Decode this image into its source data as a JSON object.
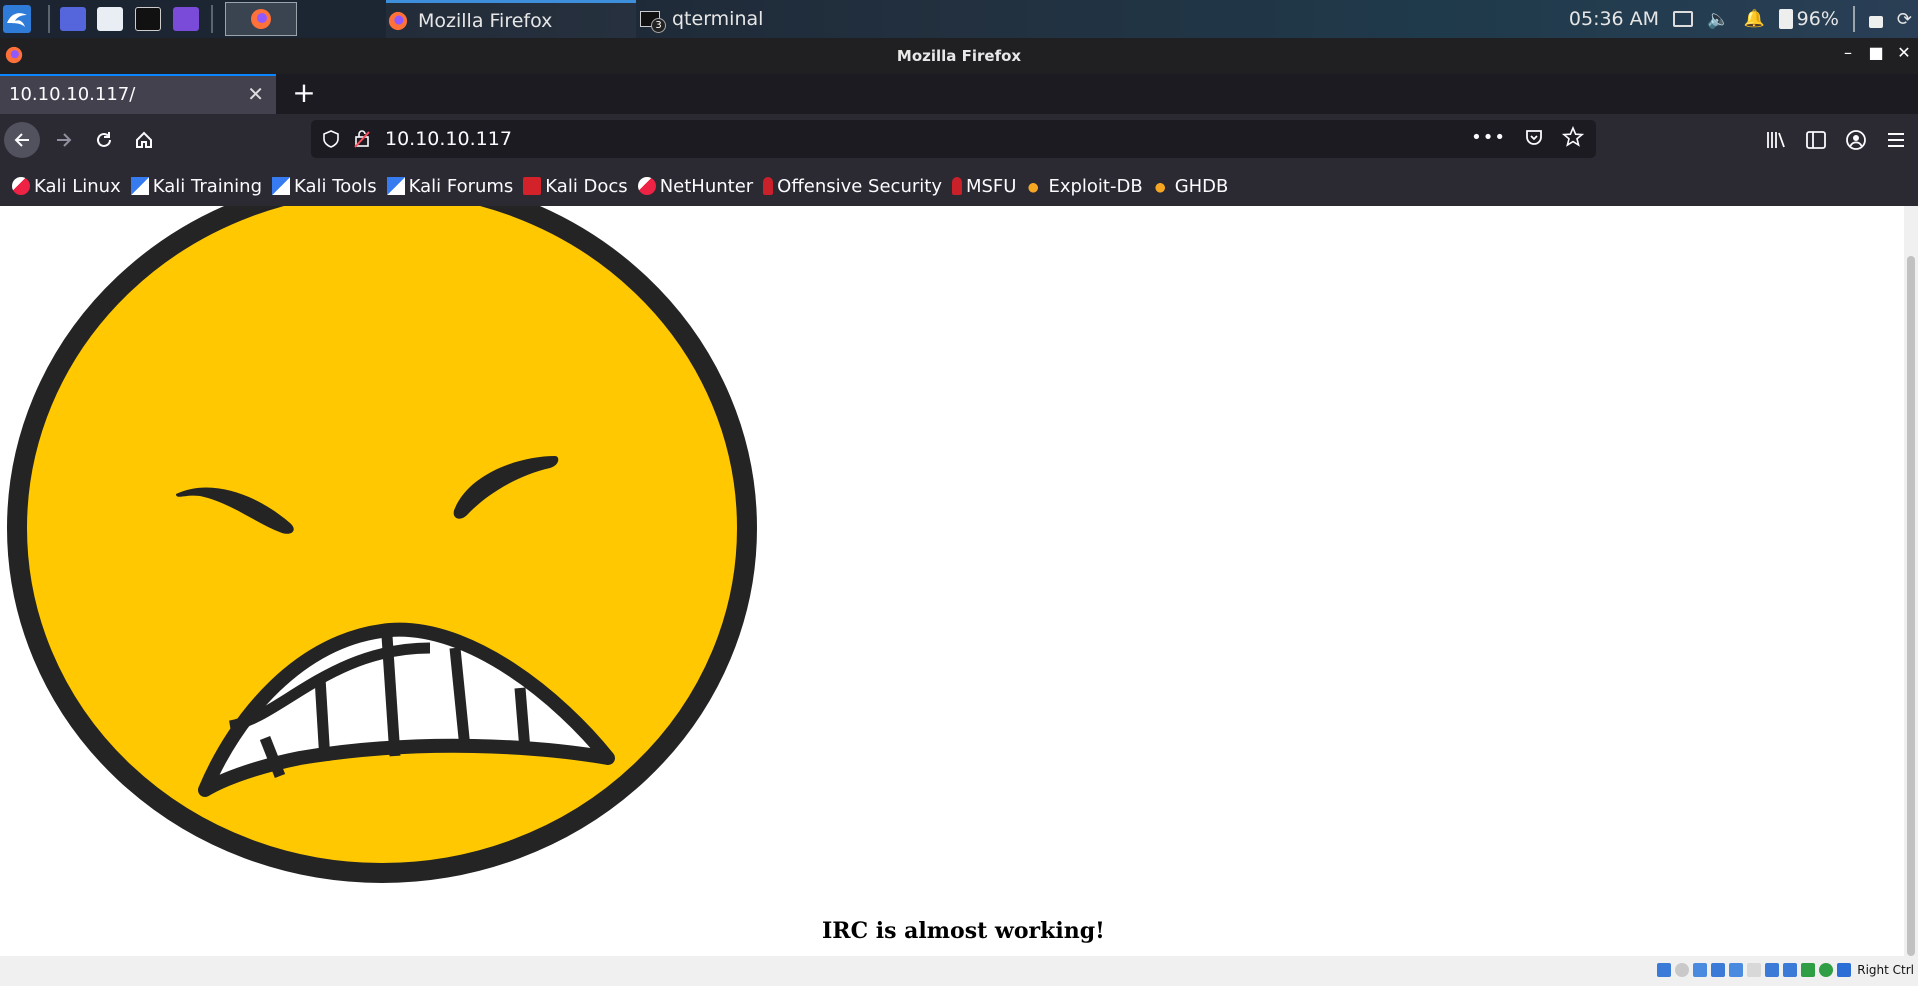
{
  "taskbar": {
    "tasks": [
      {
        "label": "Mozilla Firefox"
      },
      {
        "label": "qterminal",
        "badge": "3"
      }
    ],
    "clock": "05:36 AM",
    "battery": "96%"
  },
  "window": {
    "title": "Mozilla Firefox"
  },
  "tabs": [
    {
      "title": "10.10.10.117/"
    }
  ],
  "urlbar": {
    "url": "10.10.10.117"
  },
  "bookmarks": [
    {
      "label": "Kali Linux",
      "icon": "kali-icon"
    },
    {
      "label": "Kali Training",
      "icon": "kali-training-icon"
    },
    {
      "label": "Kali Tools",
      "icon": "kali-tools-icon"
    },
    {
      "label": "Kali Forums",
      "icon": "kali-forums-icon"
    },
    {
      "label": "Kali Docs",
      "icon": "kali-docs-icon"
    },
    {
      "label": "NetHunter",
      "icon": "nethunter-icon"
    },
    {
      "label": "Offensive Security",
      "icon": "offsec-icon"
    },
    {
      "label": "MSFU",
      "icon": "msfu-icon"
    },
    {
      "label": "Exploit-DB",
      "icon": "exploitdb-icon"
    },
    {
      "label": "GHDB",
      "icon": "ghdb-icon"
    }
  ],
  "page": {
    "heading": "IRC is almost working!"
  },
  "vm_status": {
    "host_key": "Right Ctrl"
  },
  "colors": {
    "accent": "#0a84ff",
    "face_fill": "#ffc800",
    "face_outline": "#222222"
  }
}
